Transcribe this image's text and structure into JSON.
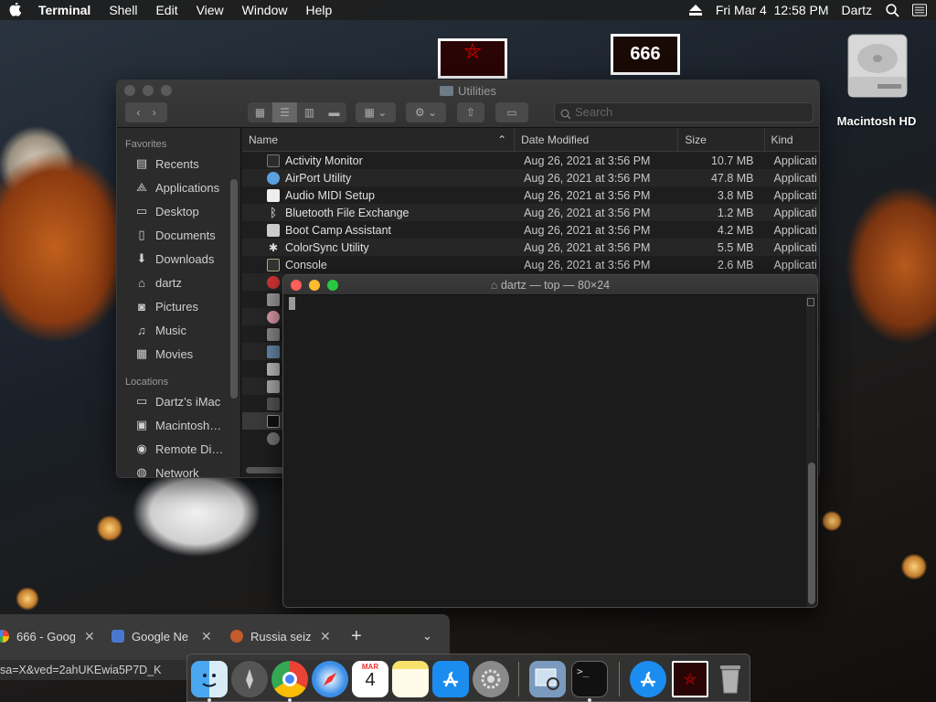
{
  "menubar": {
    "app": "Terminal",
    "items": [
      "Shell",
      "Edit",
      "View",
      "Window",
      "Help"
    ],
    "clock": "Fri Mar 4  12:58 PM",
    "user": "Dartz"
  },
  "desktop": {
    "thumb2_text": "666",
    "hd_label": "Macintosh HD"
  },
  "finder": {
    "title": "Utilities",
    "search_placeholder": "Search",
    "sidebar": {
      "favorites_label": "Favorites",
      "favorites": [
        "Recents",
        "Applications",
        "Desktop",
        "Documents",
        "Downloads",
        "dartz",
        "Pictures",
        "Music",
        "Movies"
      ],
      "locations_label": "Locations",
      "locations": [
        "Dartz’s iMac",
        "Macintosh…",
        "Remote Di…",
        "Network"
      ]
    },
    "columns": {
      "name": "Name",
      "date": "Date Modified",
      "size": "Size",
      "kind": "Kind"
    },
    "rows": [
      {
        "name": "Activity Monitor",
        "date": "Aug 26, 2021 at 3:56 PM",
        "size": "10.7 MB",
        "kind": "Applicati"
      },
      {
        "name": "AirPort Utility",
        "date": "Aug 26, 2021 at 3:56 PM",
        "size": "47.8 MB",
        "kind": "Applicati"
      },
      {
        "name": "Audio MIDI Setup",
        "date": "Aug 26, 2021 at 3:56 PM",
        "size": "3.8 MB",
        "kind": "Applicati"
      },
      {
        "name": "Bluetooth File Exchange",
        "date": "Aug 26, 2021 at 3:56 PM",
        "size": "1.2 MB",
        "kind": "Applicati"
      },
      {
        "name": "Boot Camp Assistant",
        "date": "Aug 26, 2021 at 3:56 PM",
        "size": "4.2 MB",
        "kind": "Applicati"
      },
      {
        "name": "ColorSync Utility",
        "date": "Aug 26, 2021 at 3:56 PM",
        "size": "5.5 MB",
        "kind": "Applicati"
      },
      {
        "name": "Console",
        "date": "Aug 26, 2021 at 3:56 PM",
        "size": "2.6 MB",
        "kind": "Applicati"
      }
    ]
  },
  "terminal": {
    "title": "dartz — top — 80×24"
  },
  "chrome": {
    "tabs": [
      "666 - Goog",
      "Google Ne",
      "Russia seiz"
    ],
    "new_tab": "+",
    "url": "sa=X&ved=2ahUKEwia5P7D_K"
  },
  "dock": {
    "calendar_month": "MAR",
    "calendar_day": "4"
  },
  "colors": {
    "close": "#fe5f57",
    "minimize": "#febc2e",
    "zoom": "#28c840"
  }
}
